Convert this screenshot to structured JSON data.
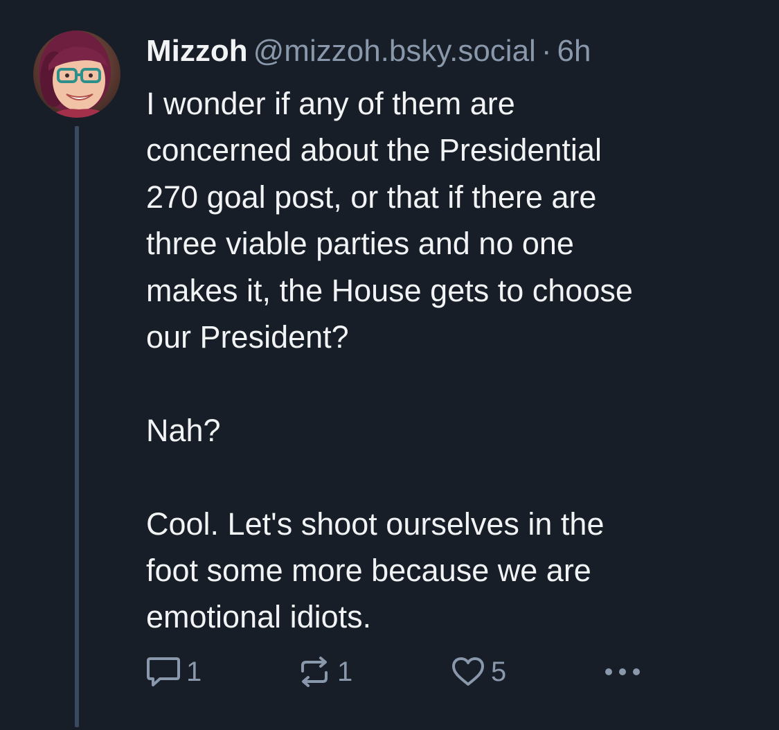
{
  "post": {
    "author": {
      "display_name": "Mizzoh",
      "handle": "@mizzoh.bsky.social",
      "avatar_icon": "avatar-photo"
    },
    "separator": "·",
    "timestamp": "6h",
    "paragraphs": [
      [
        "I wonder if any of them are",
        "concerned about the Presidential",
        "270 goal post, or that if there are",
        "three viable parties and no one",
        "makes it, the House gets to choose",
        "our President?"
      ],
      [
        "Nah?"
      ],
      [
        "Cool. Let's shoot ourselves in the",
        "foot some more because we are",
        "emotional idiots."
      ]
    ],
    "actions": {
      "reply": {
        "icon": "reply-icon",
        "count": "1"
      },
      "repost": {
        "icon": "repost-icon",
        "count": "1"
      },
      "like": {
        "icon": "heart-icon",
        "count": "5"
      },
      "more": {
        "icon": "more-icon"
      }
    }
  },
  "colors": {
    "background": "#171e27",
    "text": "#f1f3f5",
    "muted": "#8a98ac",
    "thread_line": "#3a4a60"
  }
}
